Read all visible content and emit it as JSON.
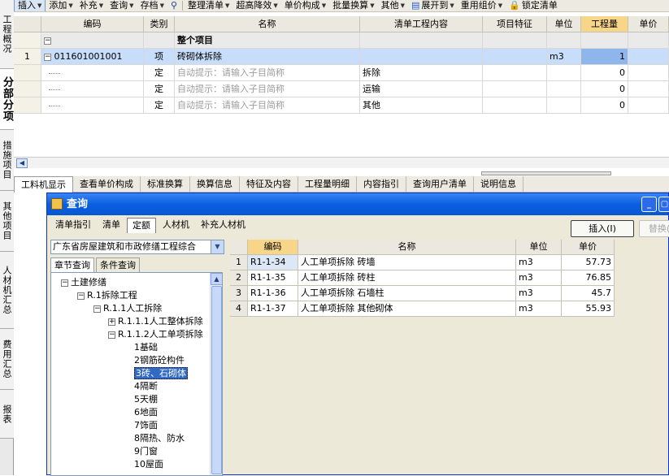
{
  "left_tabs": [
    {
      "label": "工程概况"
    },
    {
      "label": "分部分项",
      "active": true
    },
    {
      "label": "措施项目"
    },
    {
      "label": "其他项目"
    },
    {
      "label": "人材机汇总"
    },
    {
      "label": "费用汇总"
    },
    {
      "label": "报表"
    }
  ],
  "toolbar": {
    "items": [
      {
        "label": "插入"
      },
      {
        "label": "添加"
      },
      {
        "label": "补充"
      },
      {
        "label": "查询"
      },
      {
        "label": "存档"
      },
      {
        "label": "整理清单"
      },
      {
        "label": "超高降效"
      },
      {
        "label": "单价构成"
      },
      {
        "label": "批量换算"
      },
      {
        "label": "其他"
      },
      {
        "label": "展开到"
      },
      {
        "label": "重用组价"
      },
      {
        "label": "锁定清单"
      }
    ]
  },
  "top_grid": {
    "headers": [
      "编码",
      "类别",
      "名称",
      "清单工程内容",
      "项目特征",
      "单位",
      "工程量",
      "单价"
    ],
    "rows": [
      {
        "num": "",
        "code": "",
        "type": "",
        "name": "整个项目",
        "content": "",
        "feature": "",
        "unit": "",
        "qty": ""
      },
      {
        "num": "1",
        "code": "011601001001",
        "type": "项",
        "name": "砖砌体拆除",
        "content": "",
        "feature": "",
        "unit": "m3",
        "qty": "1"
      },
      {
        "num": "",
        "code": "",
        "type": "定",
        "name": "自动提示：请输入子目简称",
        "content": "拆除",
        "feature": "",
        "unit": "",
        "qty": "0"
      },
      {
        "num": "",
        "code": "",
        "type": "定",
        "name": "自动提示：请输入子目简称",
        "content": "运输",
        "feature": "",
        "unit": "",
        "qty": "0"
      },
      {
        "num": "",
        "code": "",
        "type": "定",
        "name": "自动提示：请输入子目简称",
        "content": "其他",
        "feature": "",
        "unit": "",
        "qty": "0"
      }
    ]
  },
  "bottom_tabs": [
    "工料机显示",
    "查看单价构成",
    "标准换算",
    "换算信息",
    "特征及内容",
    "工程量明细",
    "内容指引",
    "查询用户清单",
    "说明信息"
  ],
  "query": {
    "title": "查询",
    "tabs": [
      "清单指引",
      "清单",
      "定额",
      "人材机",
      "补充人材机"
    ],
    "active_tab": "定额",
    "insert_button": "插入(I)",
    "replace_button": "替换(",
    "library_select": "广东省房屋建筑和市政修缮工程综合",
    "left_tabs": [
      "章节查询",
      "条件查询"
    ],
    "tree": [
      {
        "label": "土建修缮",
        "toggle": "−",
        "level": 0
      },
      {
        "label": "R.1拆除工程",
        "toggle": "−",
        "level": 1
      },
      {
        "label": "R.1.1人工拆除",
        "toggle": "−",
        "level": 2
      },
      {
        "label": "R.1.1.1人工整体拆除",
        "toggle": "+",
        "level": 3
      },
      {
        "label": "R.1.1.2人工单项拆除",
        "toggle": "−",
        "level": 3
      },
      {
        "label": "1基础",
        "toggle": "",
        "level": 4
      },
      {
        "label": "2钢筋砼构件",
        "toggle": "",
        "level": 4
      },
      {
        "label": "3砖、石砌体",
        "toggle": "",
        "level": 4,
        "selected": true
      },
      {
        "label": "4隔断",
        "toggle": "",
        "level": 4
      },
      {
        "label": "5天棚",
        "toggle": "",
        "level": 4
      },
      {
        "label": "6地面",
        "toggle": "",
        "level": 4
      },
      {
        "label": "7饰面",
        "toggle": "",
        "level": 4
      },
      {
        "label": "8隔热、防水",
        "toggle": "",
        "level": 4
      },
      {
        "label": "9门窗",
        "toggle": "",
        "level": 4
      },
      {
        "label": "10屋面",
        "toggle": "",
        "level": 4
      }
    ],
    "table_headers": [
      "编码",
      "名称",
      "单位",
      "单价"
    ],
    "table_rows": [
      {
        "num": "1",
        "code": "R1-1-34",
        "name": "人工单项拆除 砖墙",
        "unit": "m3",
        "price": "57.73"
      },
      {
        "num": "2",
        "code": "R1-1-35",
        "name": "人工单项拆除 砖柱",
        "unit": "m3",
        "price": "76.85"
      },
      {
        "num": "3",
        "code": "R1-1-36",
        "name": "人工单项拆除 石墙柱",
        "unit": "m3",
        "price": "45.7"
      },
      {
        "num": "4",
        "code": "R1-1-37",
        "name": "人工单项拆除 其他砌体",
        "unit": "m3",
        "price": "55.93"
      }
    ]
  }
}
